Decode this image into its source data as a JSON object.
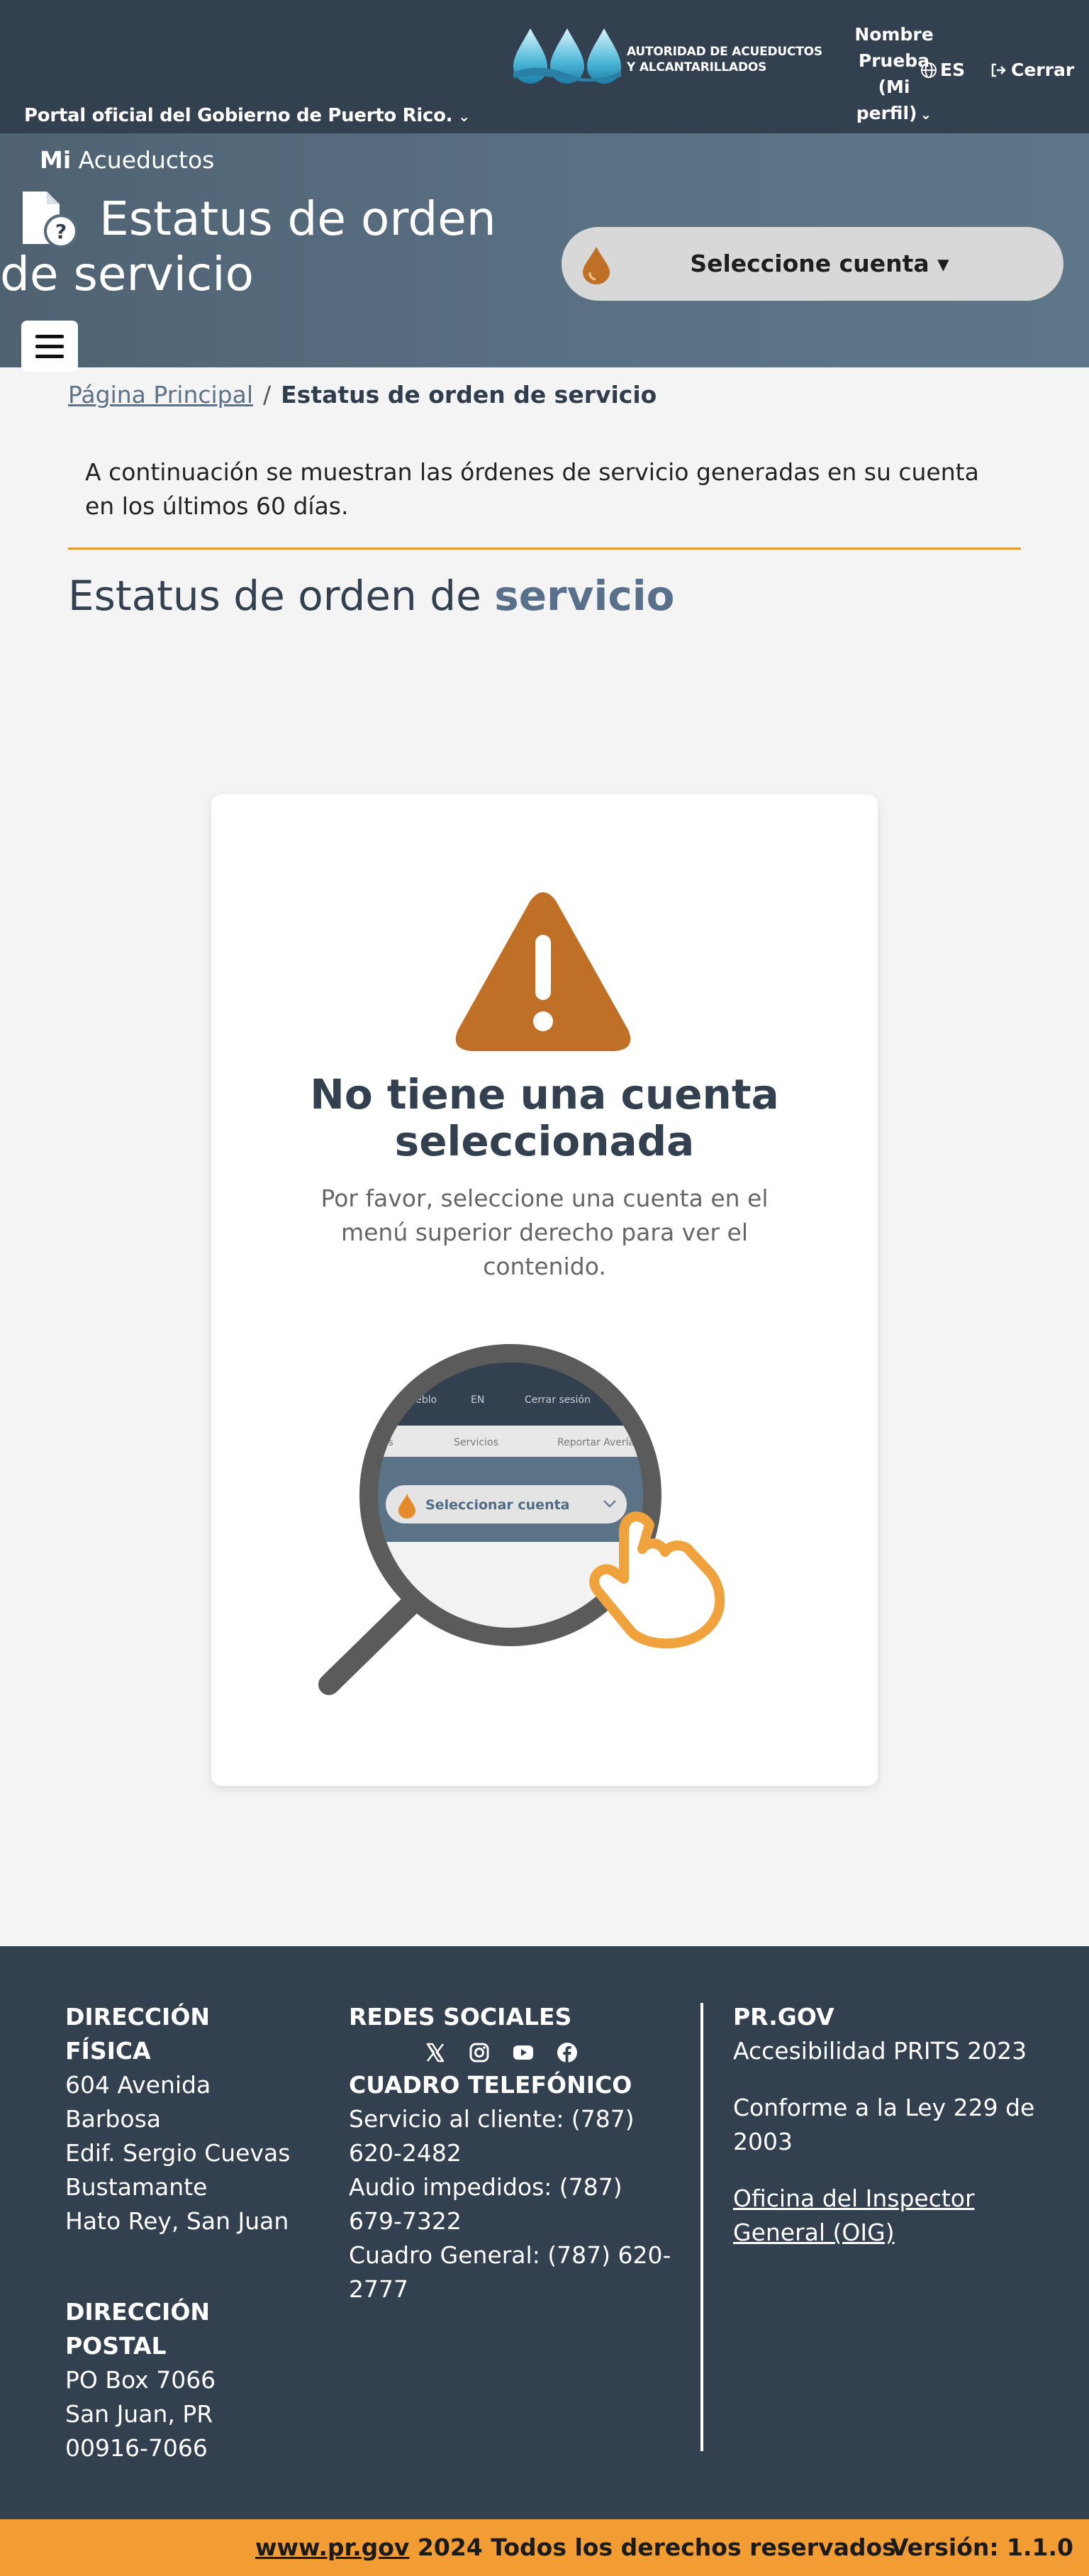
{
  "header": {
    "portal_label": "Portal oficial del Gobierno de Puerto Rico.",
    "logo_line1": "AUTORIDAD DE ACUEDUCTOS",
    "logo_line2": "Y ALCANTARILLADOS",
    "user_label": "Nombre Prueba (Mi perfil)",
    "language": "ES",
    "logout_label": "Cerrar"
  },
  "hero": {
    "brand_bold": "Mi",
    "brand_rest": "Acueductos",
    "title": "Estatus de orden de servicio",
    "account_selector_label": "Seleccione cuenta ▾",
    "menu_icon": "hamburger-menu-icon"
  },
  "breadcrumb": {
    "home": "Página Principal",
    "separator": "/",
    "current": "Estatus de orden de servicio"
  },
  "intro": "A continuación se muestran las órdenes de servicio generadas en su cuenta en los últimos 60 días.",
  "section_title": {
    "plain": "Estatus de orden de",
    "accent": "servicio"
  },
  "empty_state": {
    "icon": "warning-icon",
    "title": "No tiene una cuenta seleccionada",
    "message": "Por favor, seleccione una cuenta en el menú superior derecho para ver el contenido.",
    "illustration": {
      "top_items": [
        "...ueblo",
        "EN",
        "Cerrar sesión"
      ],
      "menu_items": [
        "...s",
        "Servicios",
        "Reportar Averías"
      ],
      "select_label": "Seleccionar cuenta"
    }
  },
  "footer": {
    "address_title": "DIRECCIÓN FÍSICA",
    "address_lines": [
      "604 Avenida",
      "Barbosa",
      "Edif. Sergio Cuevas",
      "Bustamante",
      "Hato Rey, San Juan"
    ],
    "postal_title": "DIRECCIÓN POSTAL",
    "postal_lines": [
      "PO Box 7066",
      "San Juan, PR",
      "00916-7066"
    ],
    "social_title": "REDES SOCIALES",
    "phone_title": "CUADRO TELEFÓNICO",
    "phone_customer": "Servicio al cliente: (787) 620-2482",
    "phone_audio": "Audio impedidos: (787) 679-7322",
    "phone_general": "Cuadro General: (787) 620-2777",
    "prgov_title": "PR.GOV",
    "accessibility": "Accesibilidad PRITS 2023",
    "law": "Conforme a la Ley 229 de 2003",
    "oig_link": "Oficina del Inspector General (OIG)"
  },
  "bottom_bar": {
    "site_link": "www.pr.gov",
    "rights": " 2024 Todos los derechos reservados",
    "version": "Versión: 1.1.0"
  },
  "colors": {
    "topbar": "#33404f",
    "hero": "#5a7184",
    "accent_orange": "#e39a2e",
    "warning": "#c06f26",
    "footer": "#33404f",
    "bottom_bar": "#f29c34"
  }
}
